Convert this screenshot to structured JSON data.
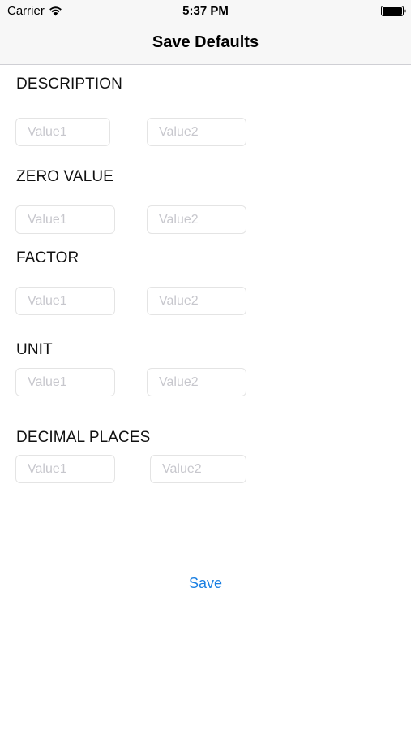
{
  "status_bar": {
    "carrier": "Carrier",
    "time": "5:37 PM"
  },
  "nav": {
    "title": "Save Defaults"
  },
  "sections": [
    {
      "label": "DESCRIPTION",
      "value1_placeholder": "Value1",
      "value2_placeholder": "Value2"
    },
    {
      "label": "ZERO VALUE",
      "value1_placeholder": "Value1",
      "value2_placeholder": "Value2"
    },
    {
      "label": "FACTOR",
      "value1_placeholder": "Value1",
      "value2_placeholder": "Value2"
    },
    {
      "label": "UNIT",
      "value1_placeholder": "Value1",
      "value2_placeholder": "Value2"
    },
    {
      "label": "DECIMAL PLACES",
      "value1_placeholder": "Value1",
      "value2_placeholder": "Value2"
    }
  ],
  "actions": {
    "save_label": "Save"
  },
  "icons": {
    "wifi": "wifi-icon",
    "battery": "battery-icon"
  },
  "colors": {
    "accent": "#1a7fe2",
    "bar_background": "#f7f7f7",
    "placeholder": "#c7c7cd",
    "field_border": "#e4e4e4"
  }
}
